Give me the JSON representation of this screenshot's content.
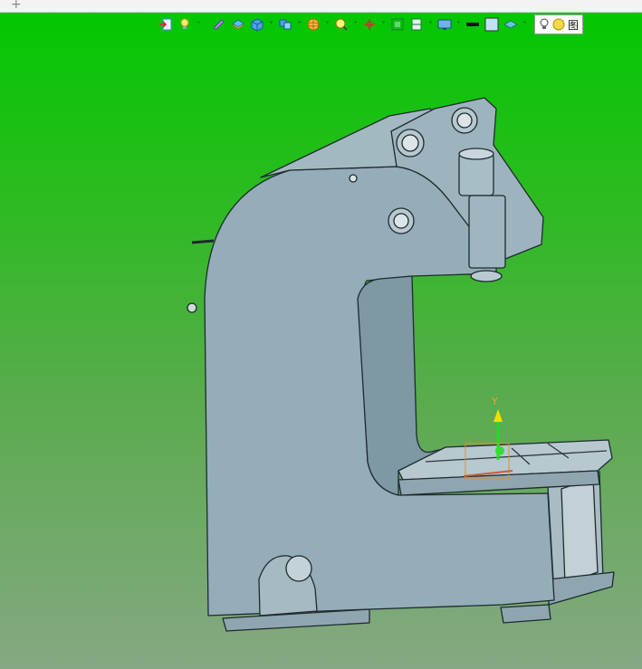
{
  "window": {
    "new_tab_glyph": "+"
  },
  "toolbar": {
    "items": [
      {
        "icon": "import-icon",
        "color": "#3a8ad6"
      },
      {
        "icon": "pointer-bulb-icon",
        "color": "#e6b800"
      },
      {
        "icon": "pencil-icon",
        "color": "#6a5acd"
      },
      {
        "icon": "layer-icon",
        "color": "#2f9fd8"
      },
      {
        "icon": "cube-icon",
        "color": "#2e86de"
      },
      {
        "icon": "multi-cube-icon",
        "color": "#2e86de"
      },
      {
        "icon": "sphere-orbit-icon",
        "color": "#f39c12"
      },
      {
        "icon": "zoom-icon",
        "color": "#e0c000"
      },
      {
        "icon": "orient-axes-icon",
        "color": "#c0392b"
      },
      {
        "icon": "fit-view-icon",
        "color": "#27ae60"
      },
      {
        "icon": "section-view-icon",
        "color": "#27ae60"
      },
      {
        "icon": "display-monitor-icon",
        "color": "#2980b9"
      },
      {
        "icon": "edge-line-icon",
        "color": "#111111"
      },
      {
        "icon": "background-color-icon",
        "color": "#bfe3f5"
      },
      {
        "icon": "layer-visibility-icon",
        "color": "#4fb7c9"
      }
    ],
    "search": {
      "label": "图"
    }
  },
  "viewport": {
    "background_top": "#00c800",
    "background_bottom": "#86a883",
    "model_color": "#94adb8",
    "axis": {
      "y_label": "Y",
      "x_color": "#f0a030",
      "y_color": "#30e030"
    }
  }
}
